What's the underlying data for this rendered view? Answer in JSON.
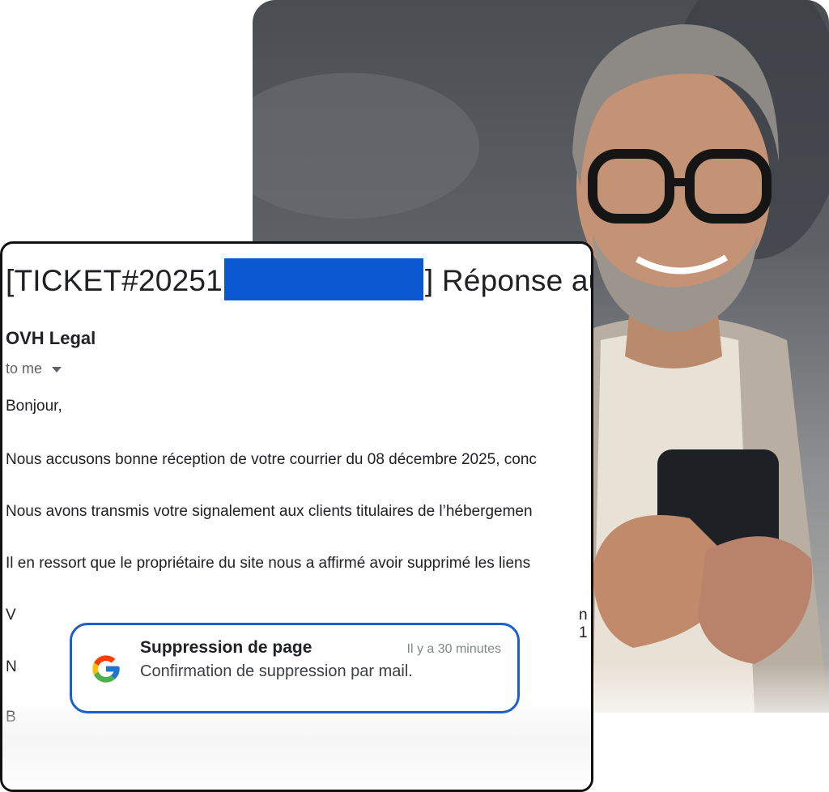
{
  "email": {
    "subject_prefix": "[TICKET#20251",
    "subject_suffix": "] Réponse au",
    "sender": "OVH Legal",
    "recipient": "to me",
    "paragraphs": [
      "Bonjour,",
      "Nous accusons bonne réception de votre courrier du 08 décembre 2025, conc",
      "Nous avons transmis votre signalement aux clients titulaires de l’hébergemen",
      "Il en ressort que le propriétaire du site nous a affirmé avoir supprimé les liens"
    ],
    "cut_fragments": [
      "V",
      "n 1",
      "N",
      "B"
    ]
  },
  "notification": {
    "title": "Suppression de page",
    "time": "Il y a 30 minutes",
    "body": "Confirmation de suppression par mail.",
    "app_icon": "google-g-icon"
  },
  "colors": {
    "redaction": "#0b57d0",
    "notification_border": "#1a5fd0",
    "card_border": "#111111"
  }
}
